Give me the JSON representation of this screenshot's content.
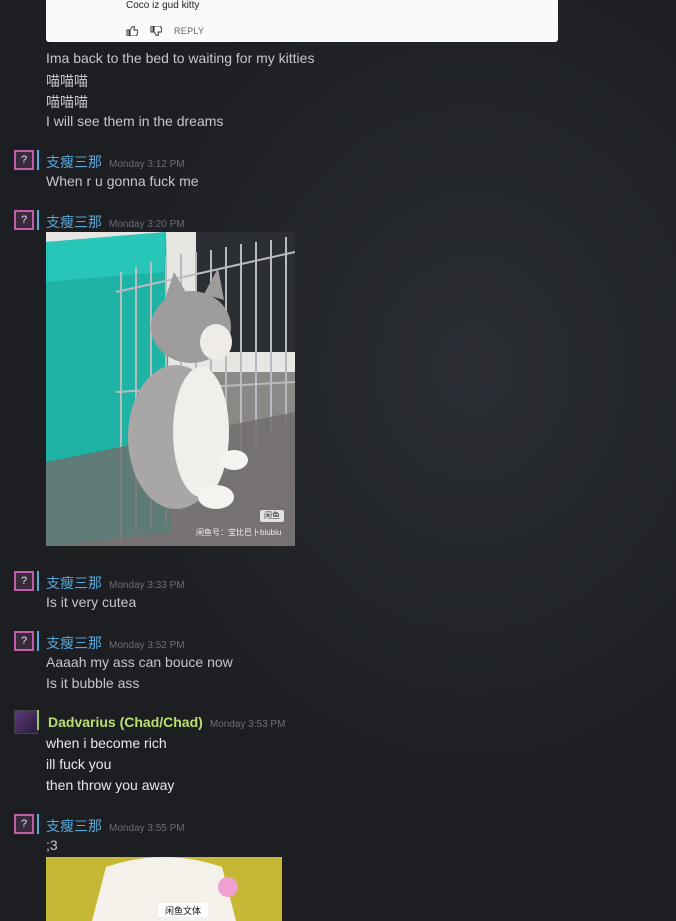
{
  "youtube_comment": {
    "text": "Coco iz gud kitty",
    "reply_label": "REPLY"
  },
  "loose_lines": [
    "Ima back to the bed to waiting for my kitties",
    "喵喵喵",
    "喵喵喵",
    "I will see them in the dreams"
  ],
  "messages": [
    {
      "author": "支瘦三那",
      "time": "Monday 3:12 PM",
      "lines": [
        "When r u gonna fuck me"
      ]
    },
    {
      "author": "支瘦三那",
      "time": "Monday 3:20 PM",
      "image": "kitten-photo",
      "image_watermark": "闲鱼",
      "image_caption": "闲鱼号：宝比巴卜biubiu"
    },
    {
      "author": "支瘦三那",
      "time": "Monday 3:33 PM",
      "lines": [
        "Is it very cutea"
      ]
    },
    {
      "author": "支瘦三那",
      "time": "Monday 3:52 PM",
      "lines": [
        "Aaaah my ass can bouce now",
        "Is it bubble ass"
      ]
    },
    {
      "author": "Dadvarius (Chad/Chad)",
      "time": "Monday 3:53 PM",
      "lines": [
        "when i become rich",
        "ill fuck you",
        "then throw you away"
      ]
    },
    {
      "author": "支瘦三那",
      "time": "Monday 3:55 PM",
      "lines": [
        ";3"
      ],
      "image": "second-photo",
      "image_logo": "闲鱼文体"
    }
  ],
  "colors": {
    "friend_name": "#b8e06c",
    "user_name": "#5aa7d8",
    "background": "#1c1e22"
  }
}
